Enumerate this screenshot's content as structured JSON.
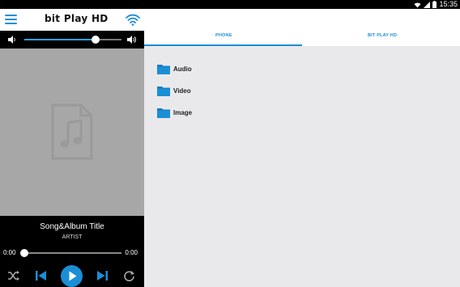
{
  "status_bar": {
    "time": "15:35",
    "icons": [
      "wifi-icon",
      "signal-icon",
      "battery-icon"
    ]
  },
  "app": {
    "title": "bit Play HD",
    "icons": [
      "menu-icon",
      "wifi-icon"
    ]
  },
  "volume": {
    "level": 0.73,
    "icons": [
      "volume-low-icon",
      "volume-high-icon"
    ]
  },
  "now_playing": {
    "song_title": "Song&Album Title",
    "artist": "ARTIST",
    "current_time": "0:00",
    "total_time": "0:00",
    "progress": 0.0,
    "controls": [
      "shuffle-icon",
      "previous-icon",
      "play-icon",
      "next-icon",
      "repeat-icon"
    ]
  },
  "tabs": [
    {
      "label": "PHONE",
      "active": true
    },
    {
      "label": "BIT PLAY HD",
      "active": false
    }
  ],
  "folders": [
    {
      "label": "Audio"
    },
    {
      "label": "Video"
    },
    {
      "label": "Image"
    }
  ],
  "colors": {
    "accent": "#1a8fd6",
    "player_bg": "#000000",
    "art_bg": "#a7a7a7",
    "content_bg": "#e9e9ec"
  }
}
